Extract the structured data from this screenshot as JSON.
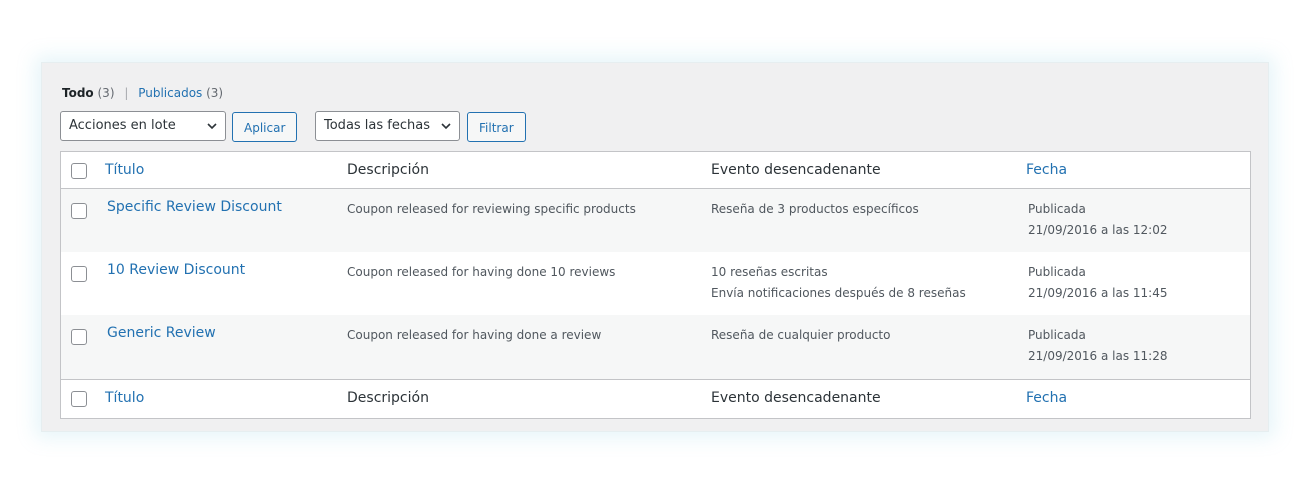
{
  "views": {
    "all_label": "Todo",
    "all_count": "(3)",
    "separator": "|",
    "published_label": "Publicados",
    "published_count": "(3)"
  },
  "toolbar": {
    "bulk_actions_value": "Acciones en lote",
    "apply_label": "Aplicar",
    "dates_value": "Todas las fechas",
    "filter_label": "Filtrar"
  },
  "columns": {
    "title": "Título",
    "description": "Descripción",
    "event": "Evento desencadenante",
    "date": "Fecha"
  },
  "rows": [
    {
      "title": "Specific Review Discount",
      "description": "Coupon released for reviewing specific products",
      "event_line1": "Reseña de 3 productos específicos",
      "event_line2": "",
      "status": "Publicada",
      "date": "21/09/2016 a las 12:02"
    },
    {
      "title": "10 Review Discount",
      "description": "Coupon released for having done 10 reviews",
      "event_line1": "10 reseñas escritas",
      "event_line2": "Envía notificaciones después de 8 reseñas",
      "status": "Publicada",
      "date": "21/09/2016 a las 11:45"
    },
    {
      "title": "Generic Review",
      "description": "Coupon released for having done a review",
      "event_line1": "Reseña de cualquier producto",
      "event_line2": "",
      "status": "Publicada",
      "date": "21/09/2016 a las 11:28"
    }
  ],
  "icons": {
    "dropdown": "chevron-down-icon"
  },
  "colors": {
    "link": "#2271b1",
    "background": "#f0f0f1",
    "border": "#c3c4c7"
  }
}
